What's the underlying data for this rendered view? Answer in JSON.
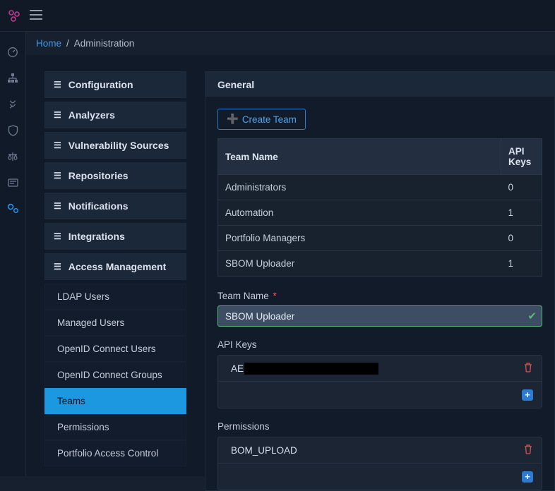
{
  "breadcrumb": {
    "home": "Home",
    "current": "Administration"
  },
  "nav": {
    "groups": [
      "Configuration",
      "Analyzers",
      "Vulnerability Sources",
      "Repositories",
      "Notifications",
      "Integrations",
      "Access Management"
    ],
    "access_items": [
      "LDAP Users",
      "Managed Users",
      "OpenID Connect Users",
      "OpenID Connect Groups",
      "Teams",
      "Permissions",
      "Portfolio Access Control"
    ],
    "active_sub": "Teams"
  },
  "panel": {
    "title": "General",
    "create_btn": "Create Team",
    "table": {
      "headers": [
        "Team Name",
        "API Keys"
      ],
      "rows": [
        {
          "name": "Administrators",
          "keys": "0"
        },
        {
          "name": "Automation",
          "keys": "1"
        },
        {
          "name": "Portfolio Managers",
          "keys": "0"
        },
        {
          "name": "SBOM Uploader",
          "keys": "1"
        }
      ]
    },
    "form": {
      "team_name_label": "Team Name",
      "team_name_value": "SBOM Uploader",
      "api_keys_label": "API Keys",
      "api_key_prefix": "AE",
      "permissions_label": "Permissions",
      "permission_value": "BOM_UPLOAD"
    }
  }
}
